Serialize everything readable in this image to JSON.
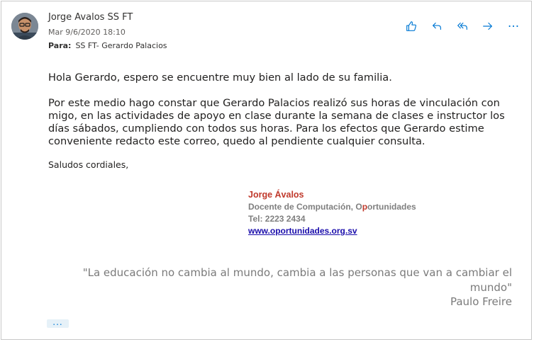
{
  "message": {
    "sender": "Jorge Avalos SS FT",
    "date": "Mar 9/6/2020 18:10",
    "to_label": "Para:",
    "to_value": "SS FT- Gerardo Palacios"
  },
  "actions": {
    "like_icon": "thumbs-up-icon",
    "reply_icon": "reply-icon",
    "reply_all_icon": "reply-all-icon",
    "forward_icon": "forward-icon",
    "more_icon": "more-icon"
  },
  "body": {
    "greeting": "Hola Gerardo, espero se encuentre muy bien al lado de su familia.",
    "paragraph": "Por este medio hago constar que Gerardo Palacios realizó sus horas de vinculación con migo, en las actividades de apoyo en clase durante la semana de clases e instructor los días sábados, cumpliendo con todos sus horas. Para los efectos que Gerardo estime conveniente redacto este correo, quedo al pendiente cualquier consulta.",
    "closing": "Saludos cordiales,"
  },
  "signature": {
    "name": "Jorge Ávalos",
    "role_part1": "Docente de Computación, ",
    "role_o": "O",
    "role_p": "p",
    "role_part2": "ortunidades",
    "tel": "Tel: 2223 2434",
    "link": "www.oportunidades.org.sv"
  },
  "quote": {
    "text": "\"La educación no cambia al mundo, cambia a las personas que van a cambiar el mundo\"",
    "author": "Paulo Freire"
  },
  "expand": {
    "label": "..."
  },
  "colors": {
    "accent": "#0078d4",
    "signature_name": "#c0392b",
    "signature_gray": "#7f7f7f",
    "link": "#1a0dab",
    "quote": "#7a7a7a"
  }
}
